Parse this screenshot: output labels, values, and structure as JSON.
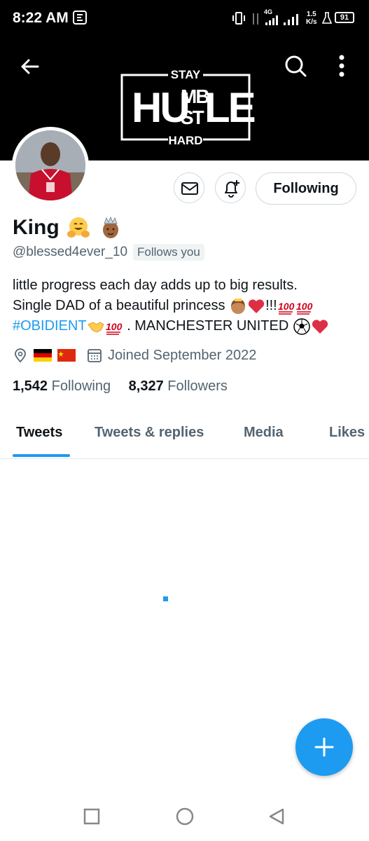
{
  "status_bar": {
    "time": "8:22 AM",
    "network": "4G",
    "speed_value": "1.5",
    "speed_unit": "K/s",
    "battery": "91"
  },
  "banner": {
    "logo_line1": "STAY",
    "logo_hu": "HU",
    "logo_mb": "MB",
    "logo_st": "ST",
    "logo_le": "LE",
    "logo_line3": "HARD"
  },
  "profile": {
    "display_name": "King",
    "handle": "@blessed4ever_10",
    "follows_you": "Follows you",
    "bio_line1": "little progress each day adds up to big results.",
    "bio_line2_text": "Single DAD of a beautiful princess",
    "bio_line2_suffix": "!!!",
    "bio_hashtag": "#OBIDIENT",
    "bio_line3_text": " . MANCHESTER UNITED",
    "joined": "Joined September 2022",
    "following_count": "1,542",
    "following_label": "Following",
    "followers_count": "8,327",
    "followers_label": "Followers"
  },
  "actions": {
    "following_button": "Following"
  },
  "tabs": [
    {
      "label": "Tweets",
      "active": true
    },
    {
      "label": "Tweets & replies",
      "active": false
    },
    {
      "label": "Media",
      "active": false
    },
    {
      "label": "Likes",
      "active": false
    }
  ],
  "colors": {
    "accent": "#1d9bf0",
    "text_primary": "#0f1419",
    "text_secondary": "#536471",
    "border": "#cfd9de"
  },
  "icons": [
    "back-arrow-icon",
    "search-icon",
    "more-vertical-icon",
    "message-icon",
    "notification-bell-icon",
    "location-icon",
    "calendar-icon",
    "compose-plus-icon",
    "recent-apps-icon",
    "home-icon",
    "back-nav-icon"
  ]
}
